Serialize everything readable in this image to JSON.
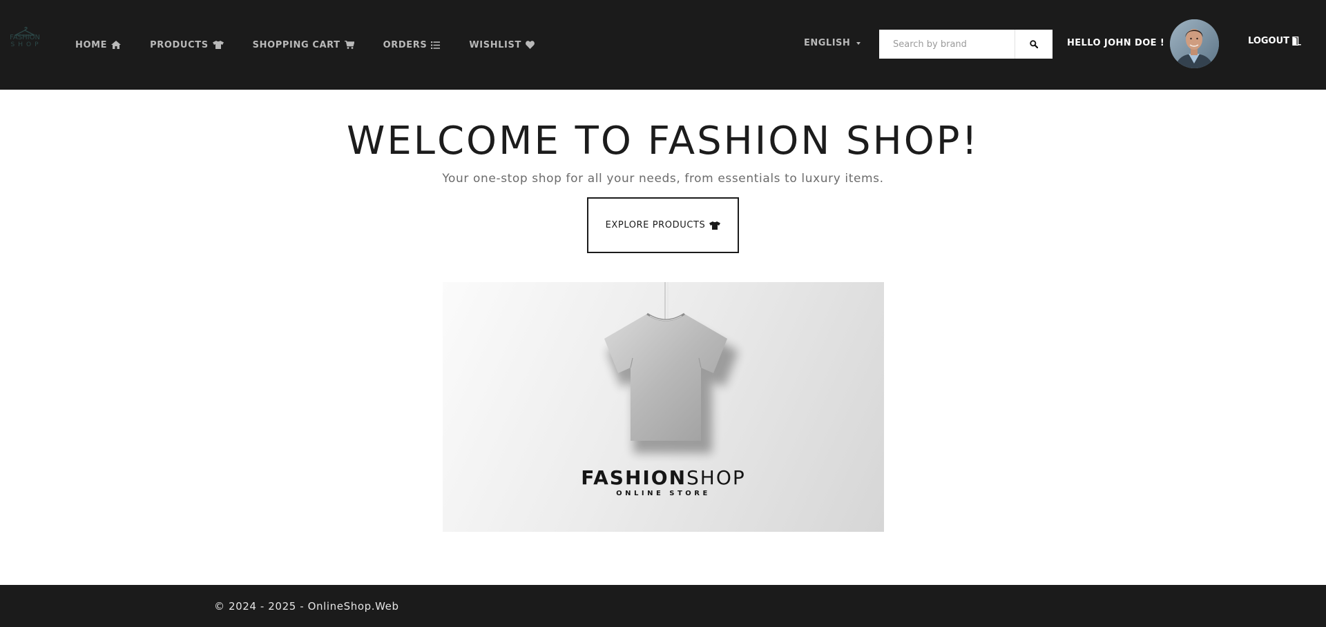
{
  "nav": {
    "logo_top": "FASHION",
    "logo_bottom": "SHOP",
    "links": [
      {
        "label": "HOME",
        "icon": "home-icon"
      },
      {
        "label": "PRODUCTS",
        "icon": "tshirt-icon"
      },
      {
        "label": "SHOPPING CART",
        "icon": "cart-icon"
      },
      {
        "label": "ORDERS",
        "icon": "list-icon"
      },
      {
        "label": "WISHLIST",
        "icon": "heart-icon"
      }
    ],
    "language": "ENGLISH",
    "search_placeholder": "Search by brand",
    "greeting": "HELLO JOHN DOE !",
    "logout_label": "LOGOUT",
    "logout_icon": "door-open-icon"
  },
  "hero": {
    "title": "WELCOME TO FASHION SHOP!",
    "subtitle": "Your one-stop shop for all your needs, from essentials to luxury items.",
    "cta_label": "EXPLORE PRODUCTS",
    "cta_icon": "tshirt-icon"
  },
  "banner": {
    "brand_bold": "FASHION",
    "brand_light": "SHOP",
    "tagline": "ONLINE STORE"
  },
  "footer": {
    "copyright": "© 2024 - 2025 - OnlineShop.Web"
  },
  "colors": {
    "navbar_bg": "#1b1b1b",
    "nav_text": "#b9b9b9",
    "page_bg": "#ffffff",
    "title_text": "#1c1c1c"
  }
}
